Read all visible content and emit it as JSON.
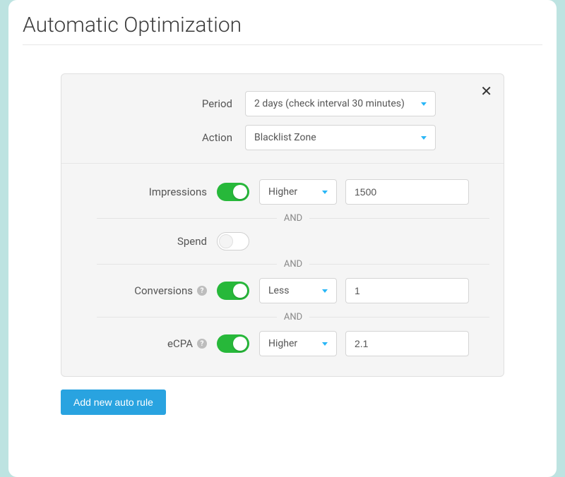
{
  "page": {
    "title": "Automatic Optimization"
  },
  "rule": {
    "period_label": "Period",
    "period_value": "2 days (check interval 30 minutes)",
    "action_label": "Action",
    "action_value": "Blacklist Zone",
    "and_text": "AND",
    "conditions": {
      "impressions": {
        "label": "Impressions",
        "enabled": true,
        "comparator": "Higher",
        "value": "1500",
        "has_help": false
      },
      "spend": {
        "label": "Spend",
        "enabled": false,
        "has_help": false
      },
      "conversions": {
        "label": "Conversions",
        "enabled": true,
        "comparator": "Less",
        "value": "1",
        "has_help": true
      },
      "ecpa": {
        "label": "eCPA",
        "enabled": true,
        "comparator": "Higher",
        "value": "2.1",
        "has_help": true
      }
    }
  },
  "buttons": {
    "add_rule": "Add new auto rule"
  }
}
